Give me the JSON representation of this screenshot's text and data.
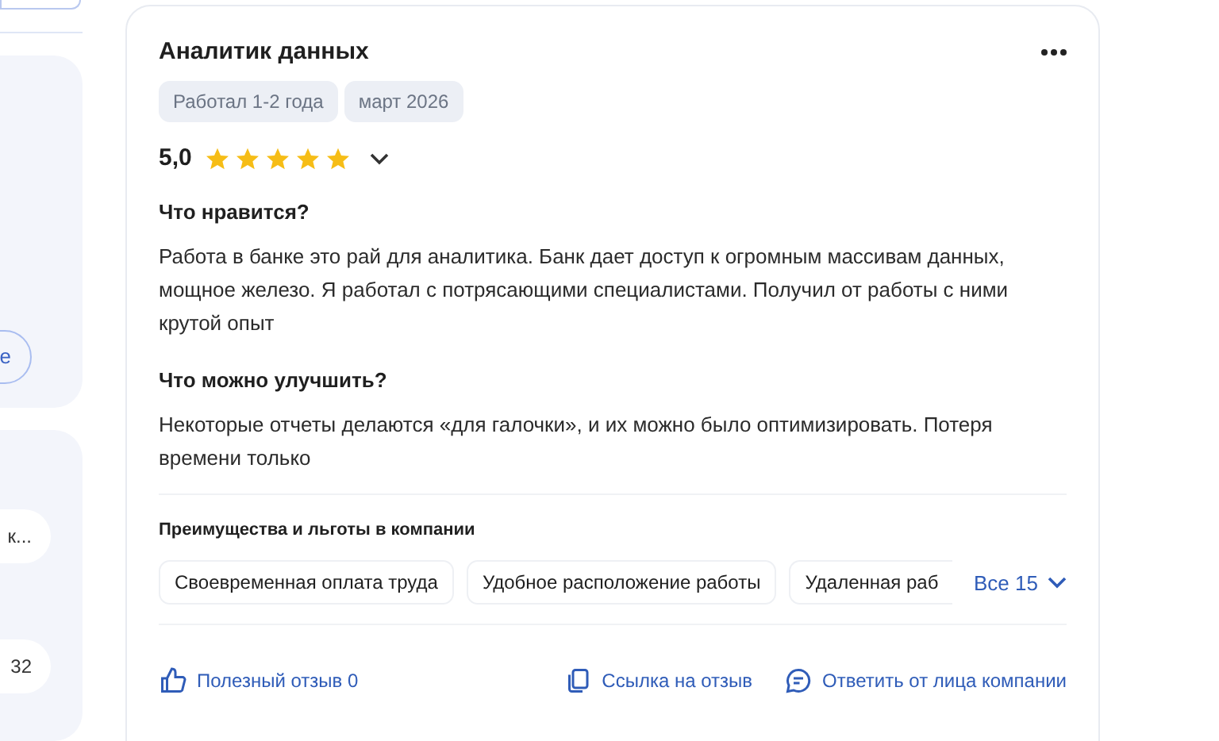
{
  "sidebar": {
    "fragments": [
      {
        "kind": "outline",
        "text": "е"
      },
      {
        "kind": "pill",
        "text": "к..."
      },
      {
        "kind": "pill",
        "text": "32"
      }
    ]
  },
  "review": {
    "title": "Аналитик данных",
    "tags": [
      "Работал 1-2 года",
      "март 2026"
    ],
    "rating": "5,0",
    "stars": 5,
    "sections": [
      {
        "heading": "Что нравится?",
        "text": "Работа в банке это рай для аналитика. Банк дает доступ к огромным массивам данных, мощное железо. Я работал с потрясающими специалистами. Получил от работы с ними крутой опыт"
      },
      {
        "heading": "Что можно улучшить?",
        "text": "Некоторые отчеты делаются «для галочки», и их можно было оптимизировать. Потеря времени только"
      }
    ],
    "benefits": {
      "heading": "Преимущества и льготы в компании",
      "items": [
        "Своевременная оплата труда",
        "Удобное расположение работы",
        "Удаленная раб"
      ],
      "more": "Все 15"
    },
    "actions": [
      {
        "kind": "like",
        "label": "Полезный отзыв 0"
      },
      {
        "kind": "link",
        "label": "Ссылка на отзыв"
      },
      {
        "kind": "reply",
        "label": "Ответить от лица компании"
      }
    ]
  }
}
